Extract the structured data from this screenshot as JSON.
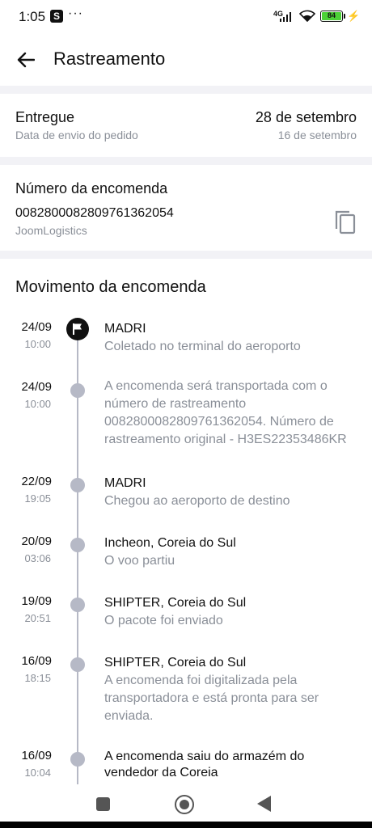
{
  "status_bar": {
    "time": "1:05",
    "app_badge": "S",
    "dots": "···",
    "network": "4G",
    "battery": "84"
  },
  "header": {
    "title": "Rastreamento"
  },
  "delivery": {
    "status": "Entregue",
    "sent_label": "Data de envio do pedido",
    "delivery_date": "28 de setembro",
    "sent_date": "16 de setembro"
  },
  "order": {
    "title": "Número da encomenda",
    "number": "0082800082809761362054",
    "carrier": "JoomLogistics"
  },
  "movement": {
    "title": "Movimento da encomenda",
    "events": [
      {
        "date": "24/09",
        "time": "10:00",
        "place": "MADRI",
        "description": "Coletado no terminal do aeroporto"
      },
      {
        "date": "24/09",
        "time": "10:00",
        "place": "",
        "description": "A encomenda será transportada com o número de rastreamento 0082800082809761362054. Número de rastreamento original - H3ES22353486KR"
      },
      {
        "date": "22/09",
        "time": "19:05",
        "place": "MADRI",
        "description": "Chegou ao aeroporto de destino"
      },
      {
        "date": "20/09",
        "time": "03:06",
        "place": "Incheon, Coreia do Sul",
        "description": "O voo partiu"
      },
      {
        "date": "19/09",
        "time": "20:51",
        "place": "SHIPTER, Coreia do Sul",
        "description": "O pacote foi enviado"
      },
      {
        "date": "16/09",
        "time": "18:15",
        "place": "SHIPTER, Coreia do Sul",
        "description": "A encomenda foi digitalizada pela transportadora e está pronta para ser enviada."
      },
      {
        "date": "16/09",
        "time": "10:04",
        "place": "A encomenda saiu do armazém do vendedor da Coreia",
        "description": ""
      }
    ]
  },
  "colors": {
    "accent_dark": "#111111",
    "timeline_grey": "#b6b9c6",
    "secondary_text": "#8a8f98",
    "section_gap": "#f2f2f6",
    "battery_green": "#4cd137"
  },
  "icons": [
    "back-arrow-icon",
    "copy-icon",
    "flag-icon",
    "wifi-icon",
    "signal-icon",
    "battery-icon",
    "charging-icon"
  ]
}
